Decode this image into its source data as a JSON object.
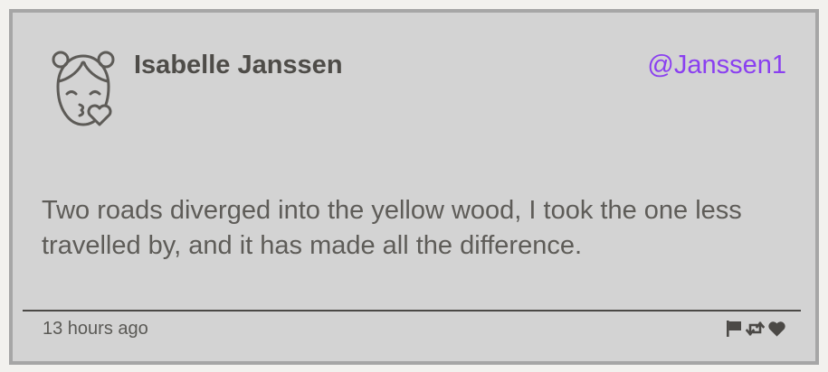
{
  "post": {
    "author_name": "Isabelle Janssen",
    "handle": "@Janssen1",
    "content": "Two roads diverged into the yellow wood, I took the one less travelled by, and it has made all the difference.",
    "timestamp": "13 hours ago",
    "avatar_icon": "girl-kiss-face-icon",
    "actions": [
      {
        "icon": "flag-icon"
      },
      {
        "icon": "retweet-icon"
      },
      {
        "icon": "heart-icon"
      }
    ]
  },
  "colors": {
    "card_background": "#d3d3d3",
    "card_border": "#a6a6a6",
    "page_background": "#f2f1ee",
    "handle_accent": "#8a3ff0",
    "text_dark": "#4e4c48",
    "text_body": "#5e5c58"
  }
}
